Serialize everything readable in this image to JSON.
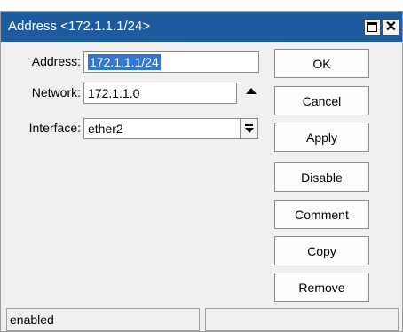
{
  "window": {
    "title": "Address <172.1.1.1/24>",
    "controls": {
      "restore_icon": "restore-icon",
      "close_glyph": "✕"
    }
  },
  "form": {
    "address": {
      "label": "Address:",
      "value": "172.1.1.1/24"
    },
    "network": {
      "label": "Network:",
      "value": "172.1.1.0"
    },
    "interface": {
      "label": "Interface:",
      "value": "ether2"
    }
  },
  "buttons": {
    "ok": "OK",
    "cancel": "Cancel",
    "apply": "Apply",
    "disable": "Disable",
    "comment": "Comment",
    "copy": "Copy",
    "remove": "Remove"
  },
  "status": {
    "left": "enabled",
    "right": ""
  },
  "colors": {
    "titlebar": "#1e5a9e",
    "selection": "#3078d8"
  }
}
